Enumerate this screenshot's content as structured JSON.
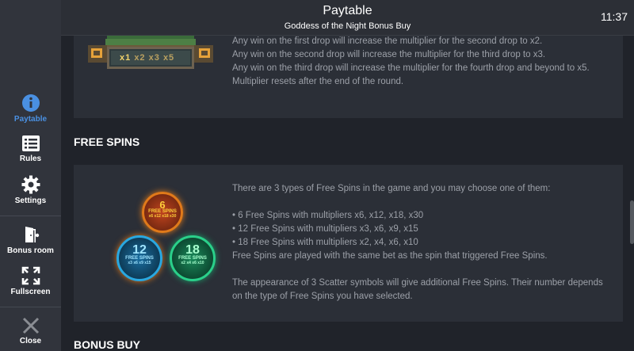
{
  "header": {
    "title": "Paytable",
    "subtitle": "Goddess of the Night Bonus Buy",
    "clock": "11:37"
  },
  "sidebar": {
    "items": [
      {
        "label": "Paytable",
        "icon": "info-icon",
        "active": true
      },
      {
        "label": "Rules",
        "icon": "list-icon"
      },
      {
        "label": "Settings",
        "icon": "gear-icon"
      },
      {
        "label": "Bonus room",
        "icon": "door-icon"
      },
      {
        "label": "Fullscreen",
        "icon": "fullscreen-icon"
      },
      {
        "label": "Close",
        "icon": "close-icon"
      }
    ]
  },
  "multiplier_panel": {
    "image_labels": [
      "x1",
      "x2",
      "x3",
      "x5"
    ],
    "lines": [
      "Any win on the first drop will increase the multiplier for the second drop to x2.",
      "Any win on the second drop will increase the multiplier for the third drop to x3.",
      "Any win on the third drop will increase the multiplier for the fourth drop and beyond to x5.",
      "Multiplier resets after the end of the round."
    ]
  },
  "free_spins": {
    "title": "FREE SPINS",
    "coins": [
      {
        "number": "6",
        "label": "FREE SPINS",
        "mults": "x6 x12 x18 x30"
      },
      {
        "number": "12",
        "label": "FREE SPINS",
        "mults": "x3 x6 x9 x15"
      },
      {
        "number": "18",
        "label": "FREE SPINS",
        "mults": "x2 x4 x6 x10"
      }
    ],
    "intro": "There are 3 types of Free Spins in the game and you may choose one of them:",
    "options": [
      "• 6 Free Spins with multipliers x6, x12, x18, x30",
      "• 12 Free Spins with multipliers x3, x6, x9, x15",
      "• 18 Free Spins with multipliers x2, x4, x6, x10"
    ],
    "bet_note": "Free Spins are played with the same bet as the spin that triggered Free Spins.",
    "scatter_note": "The appearance of 3 Scatter symbols will give additional Free Spins. Their number depends on the type of Free Spins you have selected."
  },
  "bonus_buy": {
    "title": "BONUS BUY"
  },
  "colors": {
    "sidebar_bg": "#31343c",
    "accent": "#4a90e2",
    "panel_bg": "#2b2f37",
    "coin_orange": "#e07a1a",
    "coin_blue": "#1f8fd0",
    "coin_green": "#1aa06a"
  }
}
